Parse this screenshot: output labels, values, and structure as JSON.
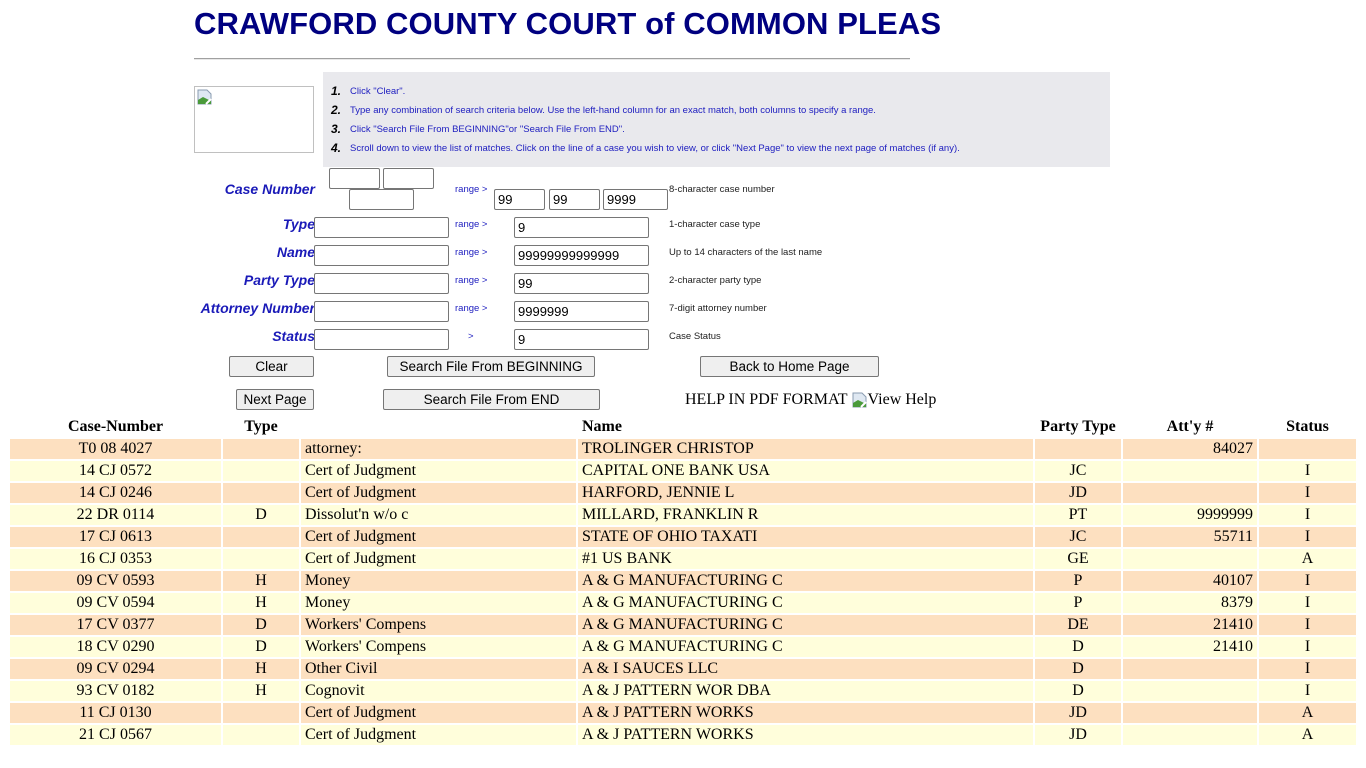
{
  "page": {
    "title": "CRAWFORD COUNTY COURT of COMMON PLEAS"
  },
  "instructions": [
    {
      "num": "1.",
      "text": "Click \"Clear\"."
    },
    {
      "num": "2.",
      "text": "Type any combination of search criteria below. Use the left-hand column for an exact match, both columns to specify a range."
    },
    {
      "num": "3.",
      "text": "Click \"Search File From BEGINNING\"or \"Search File From END\"."
    },
    {
      "num": "4.",
      "text": "Scroll down to view the list of matches. Click on the line of a case you wish to view, or click \"Next Page\" to view the next page of matches (if any)."
    }
  ],
  "form": {
    "case_number": {
      "label": "Case Number",
      "from_values": [
        "",
        "",
        ""
      ],
      "range_label": "range >",
      "to_values": [
        "99",
        "99",
        "9999"
      ],
      "hint": "8-character case number"
    },
    "type": {
      "label": "Type",
      "from_value": "",
      "range_label": "range >",
      "to_value": "9",
      "hint": "1-character case type"
    },
    "name": {
      "label": "Name",
      "from_value": "",
      "range_label": "range >",
      "to_value": "99999999999999",
      "hint": "Up to 14 characters of the last name"
    },
    "party_type": {
      "label": "Party Type",
      "from_value": "",
      "range_label": "range >",
      "to_value": "99",
      "hint": "2-character party type"
    },
    "attorney_number": {
      "label": "Attorney Number",
      "from_value": "",
      "range_label": "range >",
      "to_value": "9999999",
      "hint": "7-digit attorney number"
    },
    "status": {
      "label": "Status",
      "from_value": "",
      "range_label": ">",
      "to_value": "9",
      "hint": "Case Status"
    }
  },
  "buttons": {
    "clear": "Clear",
    "search_beginning": "Search File From BEGINNING",
    "back_home": "Back to Home Page",
    "next_page": "Next Page",
    "search_end": "Search File From END"
  },
  "help": {
    "label": "HELP IN PDF FORMAT",
    "link_alt": "View Help"
  },
  "colors": {
    "title": "#000080",
    "label": "#1a1ab8",
    "row_odd": "#fde0c0",
    "row_even": "#fffedb",
    "instructions_bg": "#e9e9ed"
  },
  "table": {
    "headers": {
      "case_number": "Case-Number",
      "type": "Type",
      "description": "",
      "name": "Name",
      "party_type": "Party Type",
      "attorney": "Att'y #",
      "status": "Status"
    },
    "rows": [
      {
        "case": "T0 08 4027",
        "type": "",
        "desc": "attorney:",
        "name": "TROLINGER CHRISTOP",
        "party": "",
        "atty": "84027",
        "status": ""
      },
      {
        "case": "14 CJ 0572",
        "type": "",
        "desc": "Cert of Judgment",
        "name": "CAPITAL ONE BANK USA",
        "party": "JC",
        "atty": "",
        "status": "I"
      },
      {
        "case": "14 CJ 0246",
        "type": "",
        "desc": "Cert of Judgment",
        "name": "HARFORD, JENNIE L",
        "party": "JD",
        "atty": "",
        "status": "I"
      },
      {
        "case": "22 DR 0114",
        "type": "D",
        "desc": "Dissolut'n w/o c",
        "name": "MILLARD, FRANKLIN R",
        "party": "PT",
        "atty": "9999999",
        "status": "I"
      },
      {
        "case": "17 CJ 0613",
        "type": "",
        "desc": "Cert of Judgment",
        "name": "STATE OF OHIO TAXATI",
        "party": "JC",
        "atty": "55711",
        "status": "I"
      },
      {
        "case": "16 CJ 0353",
        "type": "",
        "desc": "Cert of Judgment",
        "name": "#1 US BANK",
        "party": "GE",
        "atty": "",
        "status": "A"
      },
      {
        "case": "09 CV 0593",
        "type": "H",
        "desc": "Money",
        "name": "A & G MANUFACTURING C",
        "party": "P",
        "atty": "40107",
        "status": "I"
      },
      {
        "case": "09 CV 0594",
        "type": "H",
        "desc": "Money",
        "name": "A & G MANUFACTURING C",
        "party": "P",
        "atty": "8379",
        "status": "I"
      },
      {
        "case": "17 CV 0377",
        "type": "D",
        "desc": "Workers' Compens",
        "name": "A & G MANUFACTURING C",
        "party": "DE",
        "atty": "21410",
        "status": "I"
      },
      {
        "case": "18 CV 0290",
        "type": "D",
        "desc": "Workers' Compens",
        "name": "A & G MANUFACTURING C",
        "party": "D",
        "atty": "21410",
        "status": "I"
      },
      {
        "case": "09 CV 0294",
        "type": "H",
        "desc": "Other Civil",
        "name": "A & I SAUCES LLC",
        "party": "D",
        "atty": "",
        "status": "I"
      },
      {
        "case": "93 CV 0182",
        "type": "H",
        "desc": "Cognovit",
        "name": "A & J PATTERN WOR DBA",
        "party": "D",
        "atty": "",
        "status": "I"
      },
      {
        "case": "11 CJ 0130",
        "type": "",
        "desc": "Cert of Judgment",
        "name": "A & J PATTERN WORKS",
        "party": "JD",
        "atty": "",
        "status": "A"
      },
      {
        "case": "21 CJ 0567",
        "type": "",
        "desc": "Cert of Judgment",
        "name": "A & J PATTERN WORKS",
        "party": "JD",
        "atty": "",
        "status": "A"
      }
    ]
  }
}
